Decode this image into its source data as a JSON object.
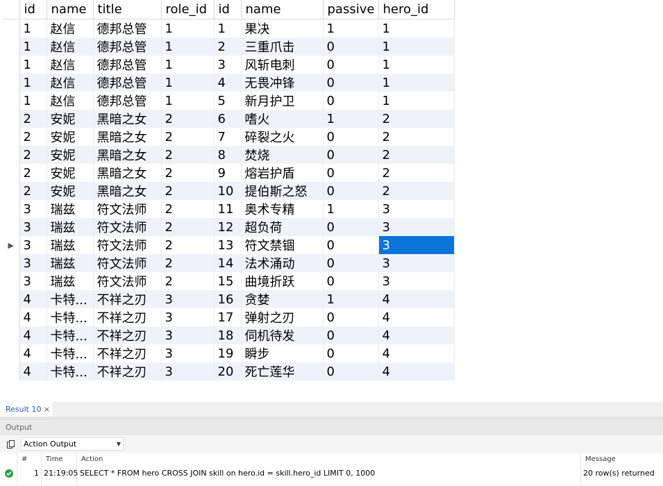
{
  "grid": {
    "columns": [
      "id",
      "name",
      "title",
      "role_id",
      "id",
      "name",
      "passive",
      "hero_id"
    ],
    "rows": [
      [
        "1",
        "赵信",
        "德邦总管",
        "1",
        "1",
        "果决",
        "1",
        "1"
      ],
      [
        "1",
        "赵信",
        "德邦总管",
        "1",
        "2",
        "三重爪击",
        "0",
        "1"
      ],
      [
        "1",
        "赵信",
        "德邦总管",
        "1",
        "3",
        "风斩电刺",
        "0",
        "1"
      ],
      [
        "1",
        "赵信",
        "德邦总管",
        "1",
        "4",
        "无畏冲锋",
        "0",
        "1"
      ],
      [
        "1",
        "赵信",
        "德邦总管",
        "1",
        "5",
        "新月护卫",
        "0",
        "1"
      ],
      [
        "2",
        "安妮",
        "黑暗之女",
        "2",
        "6",
        "嗜火",
        "1",
        "2"
      ],
      [
        "2",
        "安妮",
        "黑暗之女",
        "2",
        "7",
        "碎裂之火",
        "0",
        "2"
      ],
      [
        "2",
        "安妮",
        "黑暗之女",
        "2",
        "8",
        "焚烧",
        "0",
        "2"
      ],
      [
        "2",
        "安妮",
        "黑暗之女",
        "2",
        "9",
        "熔岩护盾",
        "0",
        "2"
      ],
      [
        "2",
        "安妮",
        "黑暗之女",
        "2",
        "10",
        "提伯斯之怒",
        "0",
        "2"
      ],
      [
        "3",
        "瑞兹",
        "符文法师",
        "2",
        "11",
        "奥术专精",
        "1",
        "3"
      ],
      [
        "3",
        "瑞兹",
        "符文法师",
        "2",
        "12",
        "超负荷",
        "0",
        "3"
      ],
      [
        "3",
        "瑞兹",
        "符文法师",
        "2",
        "13",
        "符文禁锢",
        "0",
        "3"
      ],
      [
        "3",
        "瑞兹",
        "符文法师",
        "2",
        "14",
        "法术涌动",
        "0",
        "3"
      ],
      [
        "3",
        "瑞兹",
        "符文法师",
        "2",
        "15",
        "曲境折跃",
        "0",
        "3"
      ],
      [
        "4",
        "卡特...",
        "不祥之刃",
        "3",
        "16",
        "贪婪",
        "1",
        "4"
      ],
      [
        "4",
        "卡特...",
        "不祥之刃",
        "3",
        "17",
        "弹射之刃",
        "0",
        "4"
      ],
      [
        "4",
        "卡特...",
        "不祥之刃",
        "3",
        "18",
        "伺机待发",
        "0",
        "4"
      ],
      [
        "4",
        "卡特...",
        "不祥之刃",
        "3",
        "19",
        "瞬步",
        "0",
        "4"
      ],
      [
        "4",
        "卡特...",
        "不祥之刃",
        "3",
        "20",
        "死亡莲华",
        "0",
        "4"
      ]
    ],
    "current_row_indicator": "▶",
    "selected_cell": {
      "row": 12,
      "col": 7
    }
  },
  "result_tab": {
    "label": "Result 10",
    "close": "×"
  },
  "output": {
    "header": "Output",
    "dropdown_value": "Action Output",
    "columns": {
      "num": "#",
      "time": "Time",
      "action": "Action",
      "message": "Message"
    },
    "entries": [
      {
        "num": "1",
        "time": "21:19:05",
        "action": "SELECT * FROM hero CROSS JOIN skill on hero.id = skill.hero_id LIMIT 0, 1000",
        "message": "20 row(s) returned",
        "status": "success"
      }
    ]
  },
  "colors": {
    "selection": "#0a74d8",
    "alt_row": "#eef3fb",
    "success": "#2ea043",
    "tab_text": "#1e5fb4"
  }
}
